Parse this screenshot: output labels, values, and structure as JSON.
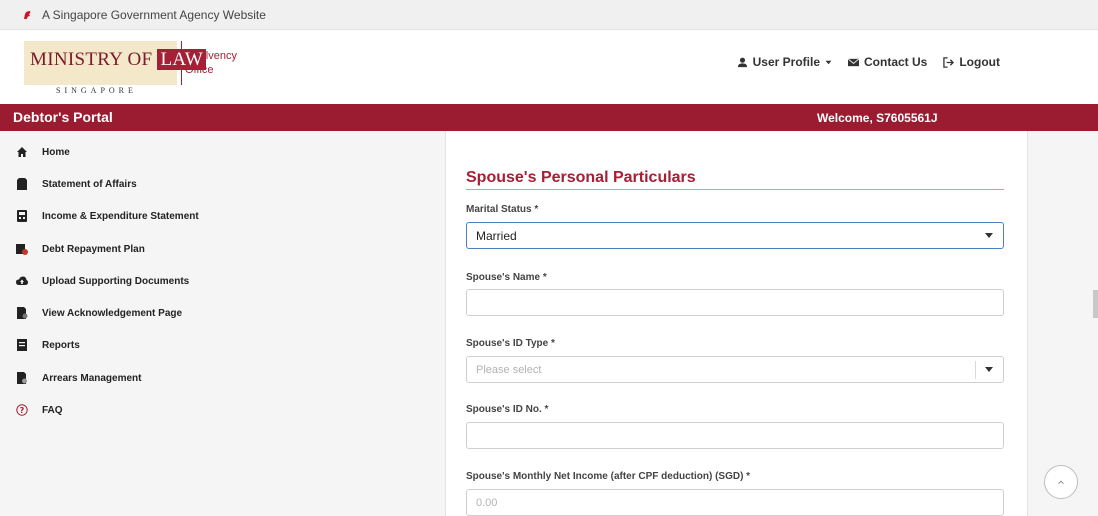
{
  "gov_banner": {
    "text": "A Singapore Government Agency Website"
  },
  "logo": {
    "ministry": "MINISTRY OF",
    "law": "LAW",
    "country": "SINGAPORE",
    "office_line1": "Insolvency",
    "office_line2": "Office"
  },
  "top_links": {
    "user_profile": "User Profile",
    "contact_us": "Contact Us",
    "logout": "Logout"
  },
  "banner": {
    "portal": "Debtor's Portal",
    "welcome": "Welcome, S7605561J"
  },
  "sidebar": {
    "items": [
      {
        "label": "Home",
        "icon": "home-icon"
      },
      {
        "label": "Statement of Affairs",
        "icon": "document-icon"
      },
      {
        "label": "Income & Expenditure Statement",
        "icon": "calculator-icon"
      },
      {
        "label": "Debt Repayment Plan",
        "icon": "payment-icon"
      },
      {
        "label": "Upload Supporting Documents",
        "icon": "cloud-upload-icon"
      },
      {
        "label": "View Acknowledgement Page",
        "icon": "file-check-icon"
      },
      {
        "label": "Reports",
        "icon": "report-icon"
      },
      {
        "label": "Arrears Management",
        "icon": "arrears-icon"
      },
      {
        "label": "FAQ",
        "icon": "question-icon"
      }
    ]
  },
  "form": {
    "section_title": "Spouse's Personal Particulars",
    "marital_status": {
      "label": "Marital Status *",
      "value": "Married"
    },
    "spouse_name": {
      "label": "Spouse's Name *",
      "value": ""
    },
    "spouse_id_type": {
      "label": "Spouse's ID Type *",
      "placeholder": "Please select"
    },
    "spouse_id_no": {
      "label": "Spouse's ID No. *",
      "value": ""
    },
    "spouse_income": {
      "label": "Spouse's Monthly Net Income (after CPF deduction) (SGD) *",
      "placeholder": "0.00"
    }
  },
  "colors": {
    "brand": "#9b1c31",
    "accent": "#a51f35",
    "focus": "#4a7fc0"
  }
}
